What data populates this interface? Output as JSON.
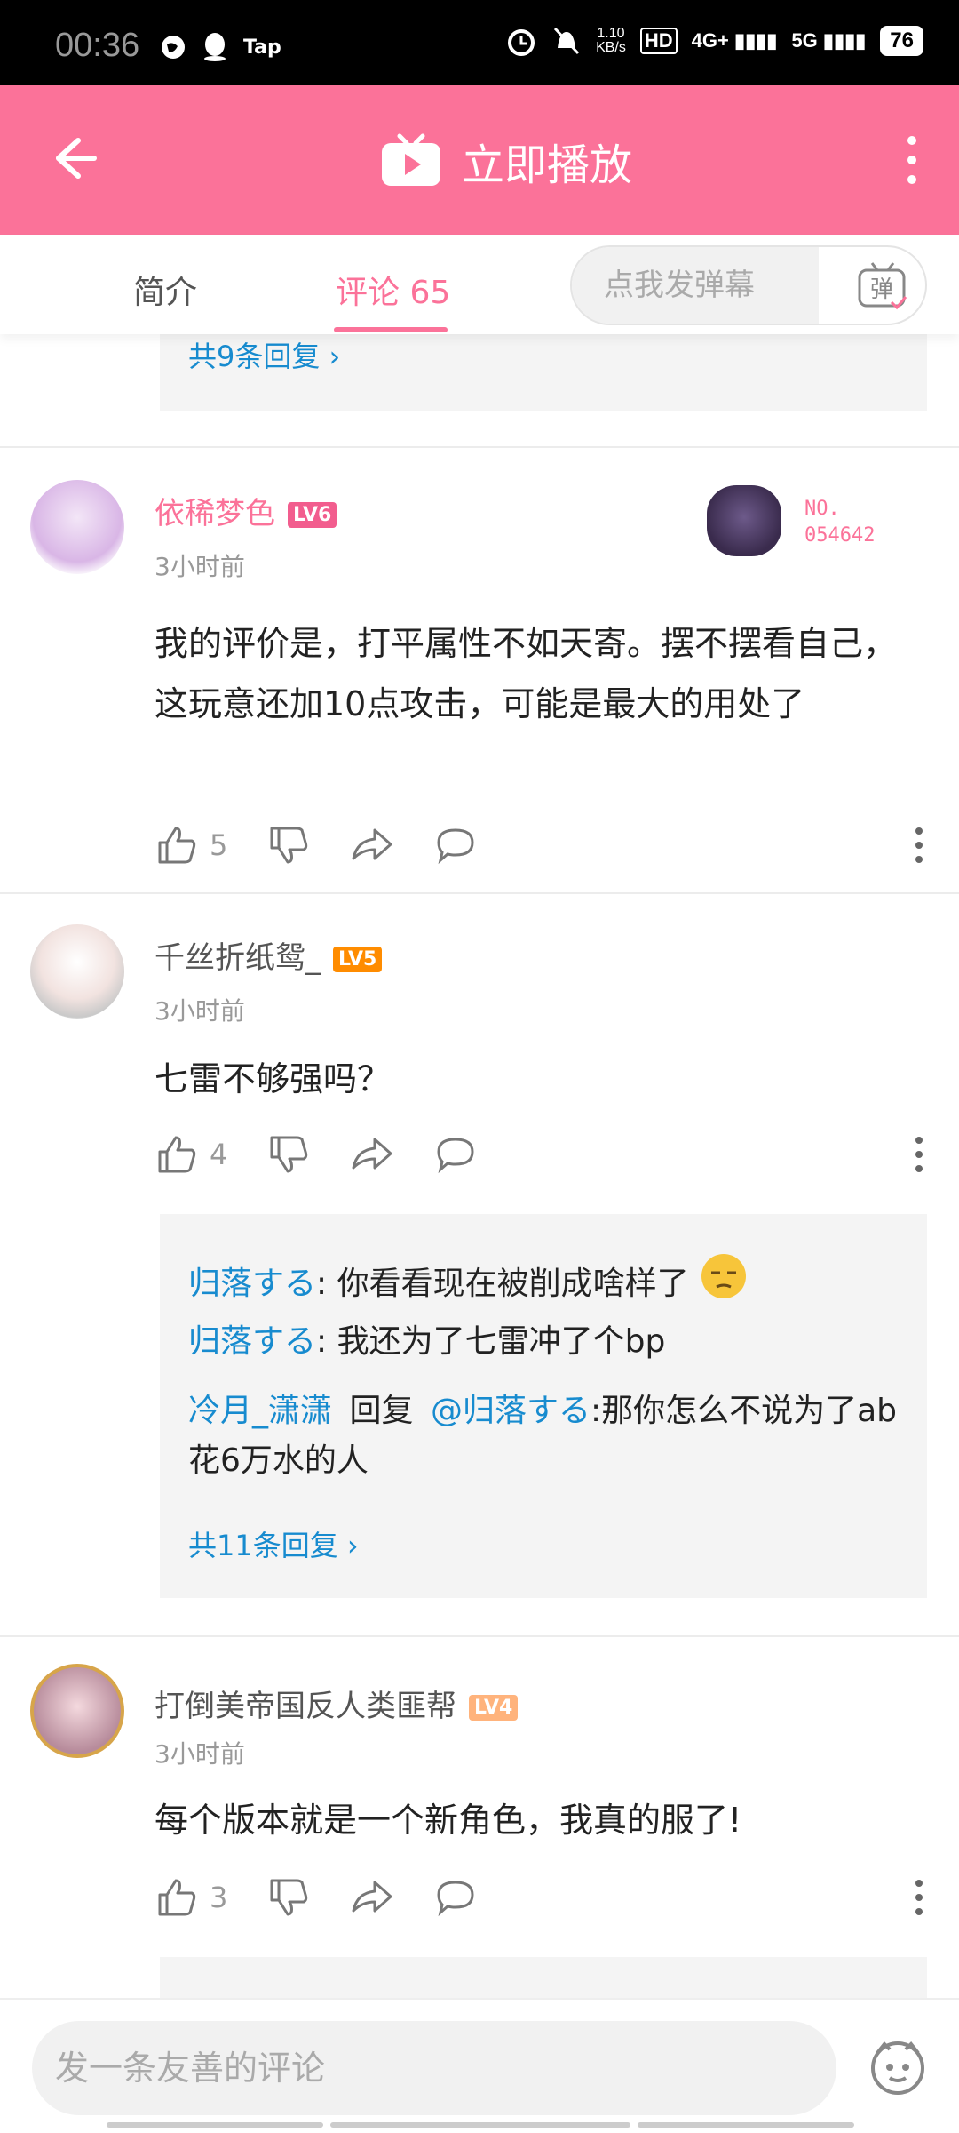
{
  "status_bar": {
    "time": "00:36",
    "tap_label": "Tap",
    "net_speed": "1.10 KB/s",
    "net_speed_value": "1.10",
    "net_speed_unit": "KB/s",
    "hd_label": "HD",
    "signal1": "4G+",
    "signal2": "5G",
    "battery": "76"
  },
  "header": {
    "title": "立即播放",
    "play_icon": "tv-play-icon"
  },
  "tabs": [
    {
      "label": "简介"
    },
    {
      "label": "评论 65"
    }
  ],
  "danmu": {
    "placeholder": "点我发弹幕",
    "button_icon": "danmaku-tv-icon",
    "button_char": "弹"
  },
  "top_reply_more": "共9条回复",
  "comments": [
    {
      "user": "依稀梦色",
      "level": "LV6",
      "time": "3小时前",
      "badge_text": "NO.\n054642",
      "badge_line1": "NO.",
      "badge_line2": "054642",
      "content": "我的评价是，打平属性不如天寄。摆不摆看自己，这玩意还加10点攻击，可能是最大的用处了",
      "likes": "5"
    },
    {
      "user": "千丝折纸鸳_",
      "level": "LV5",
      "time": "3小时前",
      "content": "七雷不够强吗？",
      "likes": "4",
      "replies": [
        {
          "user": "归落する",
          "text": "你看看现在被削成啥样了"
        },
        {
          "user": "归落する",
          "text": "我还为了七雷冲了个bp"
        },
        {
          "user": "冷月_潇潇",
          "reply_word": "回复",
          "at": "@归落する",
          "text": ":那你怎么不说为了ab花6万水的人"
        }
      ],
      "more": "共11条回复"
    },
    {
      "user": "打倒美帝国反人类匪帮",
      "level": "LV4",
      "time": "3小时前",
      "content": "每个版本就是一个新角色，我真的服了!",
      "likes": "3"
    }
  ],
  "bottom": {
    "placeholder": "发一条友善的评论"
  },
  "colors": {
    "brand": "#fb7299",
    "link": "#178bcf",
    "lv6": "#f25d8e",
    "lv5": "#ff8c00",
    "lv4": "#ffb37c"
  }
}
